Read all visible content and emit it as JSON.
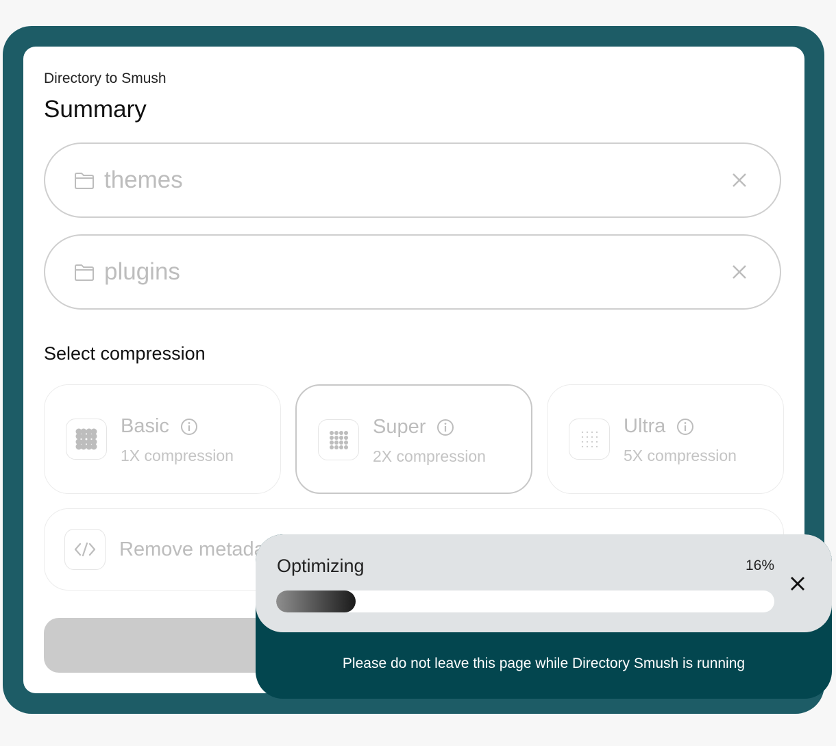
{
  "header": {
    "eyebrow": "Directory to Smush",
    "title": "Summary"
  },
  "directories": [
    {
      "name": "themes",
      "icon": "folder-icon",
      "remove_icon": "close-icon"
    },
    {
      "name": "plugins",
      "icon": "folder-icon",
      "remove_icon": "close-icon"
    }
  ],
  "compression": {
    "label": "Select compression",
    "options": [
      {
        "name": "Basic",
        "subtitle": "1X compression",
        "icon": "grid-dense-icon",
        "selected": false
      },
      {
        "name": "Super",
        "subtitle": "2X compression",
        "icon": "grid-dots-icon",
        "selected": true
      },
      {
        "name": "Ultra",
        "subtitle": "5X compression",
        "icon": "grid-sparse-icon",
        "selected": false
      }
    ]
  },
  "metadata": {
    "label": "Remove metadata",
    "icon": "code-icon"
  },
  "toast": {
    "status": "Optimizing",
    "percent_label": "16%",
    "progress": 0.16,
    "message": "Please do not leave this page while Directory Smush is running",
    "colors": {
      "bar": "#03464f",
      "panel": "#e0e3e5"
    }
  },
  "colors": {
    "frame": "#1d5c66",
    "button_disabled": "#cbcbcb"
  }
}
